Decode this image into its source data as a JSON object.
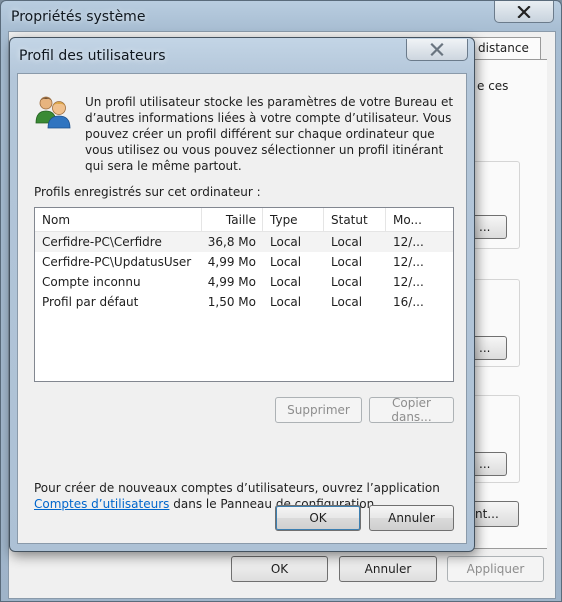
{
  "back_window": {
    "title": "Propriétés système",
    "tab_fragment": "distance",
    "text_fragment": "e ces",
    "button_fragment": "...",
    "button_fragment_2": "nt...",
    "buttons": {
      "ok": "OK",
      "cancel": "Annuler",
      "apply": "Appliquer"
    }
  },
  "dialog": {
    "title": "Profil des utilisateurs",
    "description": "Un profil utilisateur stocke les paramètres de votre Bureau et d’autres informations liées à votre compte d’utilisateur. Vous pouvez créer un profil différent sur chaque ordinateur que vous utilisez ou vous pouvez sélectionner un profil itinérant qui sera le même partout.",
    "list_label": "Profils enregistrés sur cet ordinateur :",
    "columns": [
      "Nom",
      "Taille",
      "Type",
      "Statut",
      "Mo..."
    ],
    "rows": [
      {
        "nom": "Cerfidre-PC\\Cerfidre",
        "taille": "36,8 Mo",
        "type": "Local",
        "statut": "Local",
        "modifie": "12/..."
      },
      {
        "nom": "Cerfidre-PC\\UpdatusUser",
        "taille": "4,99 Mo",
        "type": "Local",
        "statut": "Local",
        "modifie": "12/..."
      },
      {
        "nom": "Compte inconnu",
        "taille": "4,99 Mo",
        "type": "Local",
        "statut": "Local",
        "modifie": "12/..."
      },
      {
        "nom": "Profil par défaut",
        "taille": "1,50 Mo",
        "type": "Local",
        "statut": "Local",
        "modifie": "16/..."
      }
    ],
    "delete_button": "Supprimer",
    "copy_button": "Copier dans...",
    "info_prefix": "Pour créer de nouveaux comptes d’utilisateurs, ouvrez l’application",
    "info_link": "Comptes d’utilisateurs",
    "info_suffix": " dans le Panneau de configuration.",
    "ok_button": "OK",
    "cancel_button": "Annuler"
  }
}
